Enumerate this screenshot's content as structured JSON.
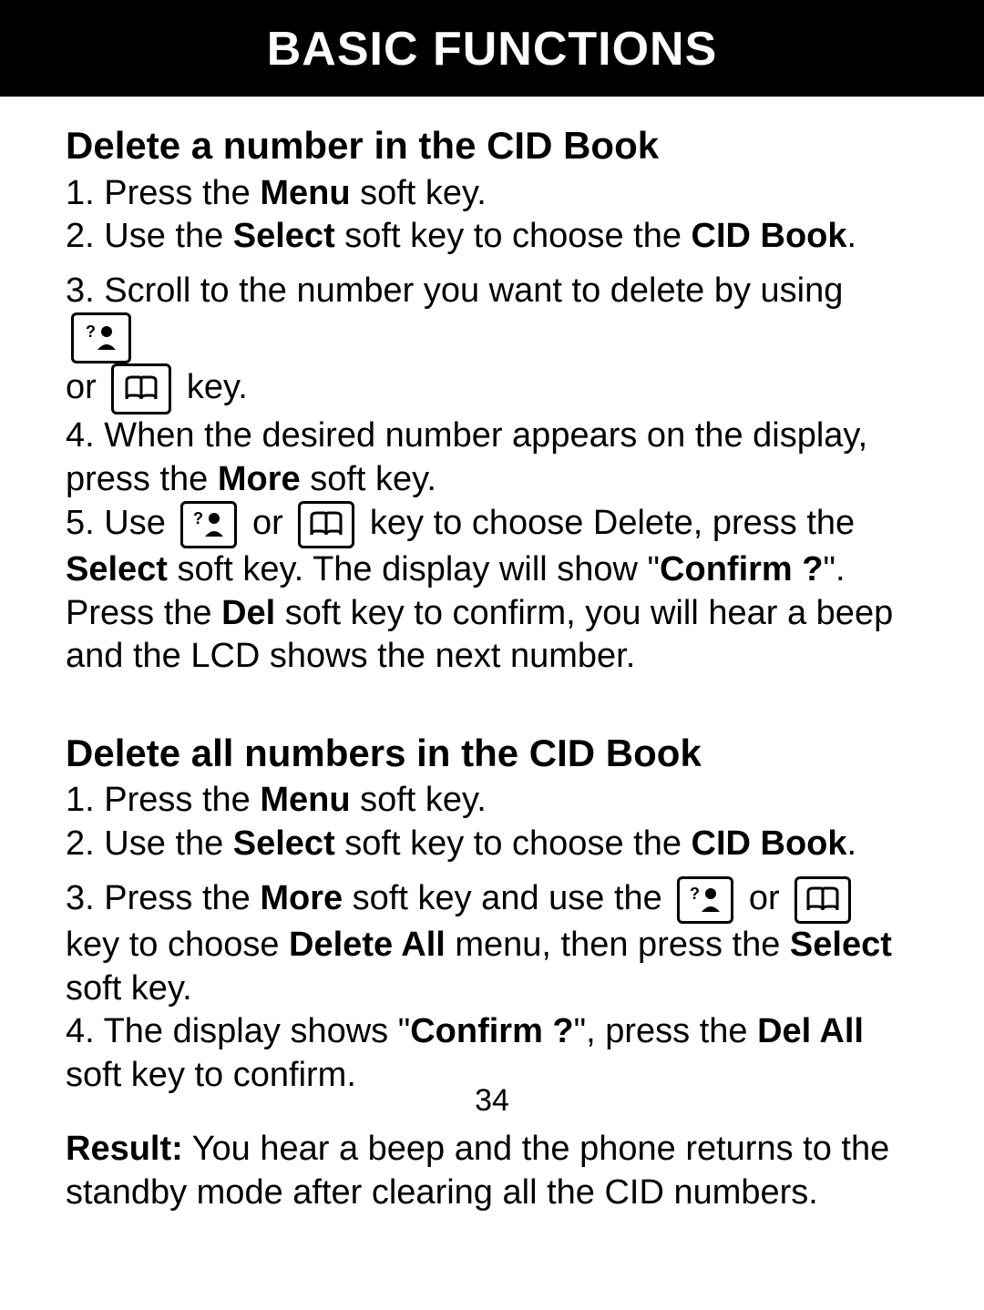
{
  "header": {
    "title": "BASIC FUNCTIONS"
  },
  "section1": {
    "title": "Delete a number in the CID Book",
    "step1_a": "1. Press the ",
    "step1_b": "Menu",
    "step1_c": " soft key.",
    "step2_a": "2. Use the ",
    "step2_b": "Select",
    "step2_c": " soft key to choose the ",
    "step2_d": "CID Book",
    "step2_e": ".",
    "step3_a": "3. Scroll to the number you want to delete by using ",
    "step3_b": "or ",
    "step3_c": " key.",
    "step4_a": "4. When the desired number appears on the display, press the ",
    "step4_b": "More",
    "step4_c": " soft key.",
    "step5_a": "5. Use ",
    "step5_b": " or ",
    "step5_c": " key to choose Delete, press the ",
    "step5_d": "Select",
    "step5_e": " soft key. The display will show \"",
    "step5_f": "Confirm ?",
    "step5_g": "\". Press the ",
    "step5_h": "Del",
    "step5_i": " soft key to confirm, you will hear a beep and the LCD shows the next number."
  },
  "section2": {
    "title": "Delete all numbers in the CID Book",
    "step1_a": "1. Press the ",
    "step1_b": "Menu",
    "step1_c": " soft key.",
    "step2_a": "2. Use the ",
    "step2_b": "Select",
    "step2_c": " soft key to choose the ",
    "step2_d": "CID Book",
    "step2_e": ".",
    "step3_a": "3. Press the ",
    "step3_b": "More",
    "step3_c": " soft key and use the ",
    "step3_d": " or ",
    "step3_e": " key to choose ",
    "step3_f": "Delete All",
    "step3_g": " menu, then press the ",
    "step3_h": "Select",
    "step3_i": " soft key.",
    "step4_a": "4. The display shows \"",
    "step4_b": "Confirm ?",
    "step4_c": "\", press the ",
    "step4_d": "Del All",
    "step4_e": " soft key to confirm.",
    "result_a": "Result:",
    "result_b": " You hear a beep and the phone returns to the standby mode after clearing all the CID numbers."
  },
  "page_number": "34"
}
